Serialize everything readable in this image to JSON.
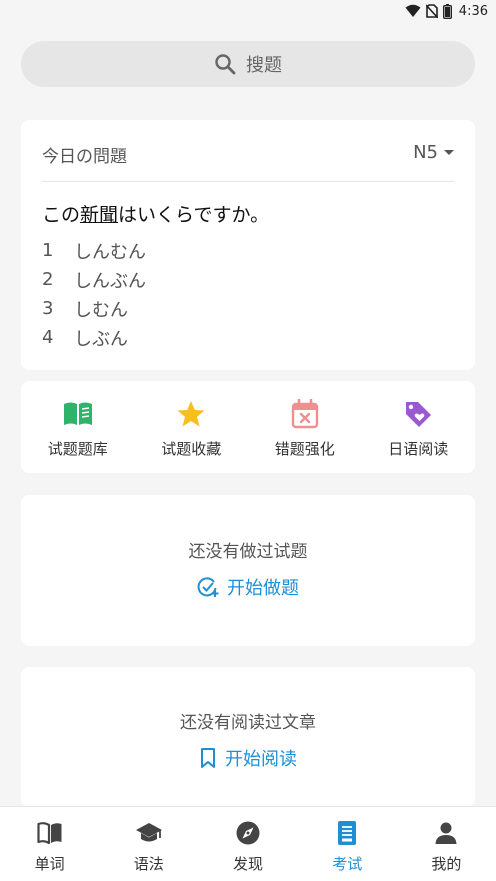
{
  "status_bar": {
    "time": "4:36"
  },
  "search": {
    "label": "搜题"
  },
  "question": {
    "header_title": "今日の問題",
    "level": "N5",
    "sentence_before": "この",
    "sentence_underlined": "新聞",
    "sentence_after": "はいくらですか。",
    "options": [
      {
        "num": "1",
        "text": "しんむん"
      },
      {
        "num": "2",
        "text": "しんぶん"
      },
      {
        "num": "3",
        "text": "しむん"
      },
      {
        "num": "4",
        "text": "しぶん"
      }
    ]
  },
  "shortcuts": [
    {
      "label": "试题题库",
      "icon": "open-book-icon",
      "color": "#2fb36b"
    },
    {
      "label": "试题收藏",
      "icon": "star-icon",
      "color": "#f6bf1d"
    },
    {
      "label": "错题强化",
      "icon": "calendar-x-icon",
      "color": "#ef8f8f"
    },
    {
      "label": "日语阅读",
      "icon": "tag-heart-icon",
      "color": "#9b59d0"
    }
  ],
  "practice_empty": {
    "message": "还没有做过试题",
    "action": "开始做题"
  },
  "reading_empty": {
    "message": "还没有阅读过文章",
    "action": "开始阅读"
  },
  "bottom_nav": {
    "active": "考试",
    "accent": "#1e8fd5",
    "items": [
      {
        "label": "单词",
        "icon": "book-icon"
      },
      {
        "label": "语法",
        "icon": "graduation-cap-icon"
      },
      {
        "label": "发现",
        "icon": "compass-icon"
      },
      {
        "label": "考试",
        "icon": "exam-document-icon"
      },
      {
        "label": "我的",
        "icon": "person-icon"
      }
    ]
  }
}
